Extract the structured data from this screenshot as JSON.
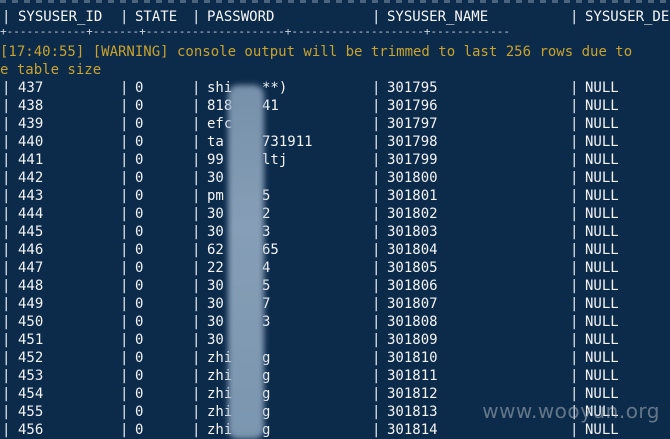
{
  "columns": [
    "SYSUSER_ID",
    "STATE",
    "PASSWORD",
    "SYSUSER_NAME",
    "SYSUSER_DE"
  ],
  "header_rule": "+------------+-------+---------------------+--------------------+------------",
  "warning_line1": "[17:40:55] [WARNING] console output will be trimmed to last 256 rows due to",
  "warning_line2": "e table size",
  "rows": [
    {
      "id": "437",
      "state": "0",
      "password": "shi",
      "password2": "**)",
      "name": "301795",
      "desc": "NULL"
    },
    {
      "id": "438",
      "state": "0",
      "password": "818",
      "password2": "41",
      "name": "301796",
      "desc": "NULL"
    },
    {
      "id": "439",
      "state": "0",
      "password": "efc",
      "password2": "",
      "name": "301797",
      "desc": "NULL"
    },
    {
      "id": "440",
      "state": "0",
      "password": "ta",
      "password2": "731911",
      "name": "301798",
      "desc": "NULL"
    },
    {
      "id": "441",
      "state": "0",
      "password": "99",
      "password2": "ltj",
      "name": "301799",
      "desc": "NULL"
    },
    {
      "id": "442",
      "state": "0",
      "password": "30",
      "password2": "",
      "name": "301800",
      "desc": "NULL"
    },
    {
      "id": "443",
      "state": "0",
      "password": "pm",
      "password2": "5",
      "name": "301801",
      "desc": "NULL"
    },
    {
      "id": "444",
      "state": "0",
      "password": "30",
      "password2": "2",
      "name": "301802",
      "desc": "NULL"
    },
    {
      "id": "445",
      "state": "0",
      "password": "30",
      "password2": "3",
      "name": "301803",
      "desc": "NULL"
    },
    {
      "id": "446",
      "state": "0",
      "password": "62",
      "password2": "65",
      "name": "301804",
      "desc": "NULL"
    },
    {
      "id": "447",
      "state": "0",
      "password": "22",
      "password2": "4",
      "name": "301805",
      "desc": "NULL"
    },
    {
      "id": "448",
      "state": "0",
      "password": "30",
      "password2": "5",
      "name": "301806",
      "desc": "NULL"
    },
    {
      "id": "449",
      "state": "0",
      "password": "30",
      "password2": "7",
      "name": "301807",
      "desc": "NULL"
    },
    {
      "id": "450",
      "state": "0",
      "password": "30",
      "password2": "3",
      "name": "301808",
      "desc": "NULL"
    },
    {
      "id": "451",
      "state": "0",
      "password": "30",
      "password2": "",
      "name": "301809",
      "desc": "NULL"
    },
    {
      "id": "452",
      "state": "0",
      "password": "zhi",
      "password2": "g",
      "name": "301810",
      "desc": "NULL"
    },
    {
      "id": "453",
      "state": "0",
      "password": "zhi",
      "password2": "g",
      "name": "301811",
      "desc": "NULL"
    },
    {
      "id": "454",
      "state": "0",
      "password": "zhi",
      "password2": "g",
      "name": "301812",
      "desc": "NULL"
    },
    {
      "id": "455",
      "state": "0",
      "password": "zhi",
      "password2": "g",
      "name": "301813",
      "desc": "NULL"
    },
    {
      "id": "456",
      "state": "0",
      "password": "zhi",
      "password2": "g",
      "name": "301814",
      "desc": "NULL"
    }
  ],
  "watermark": "www.wooyun.org",
  "colors": {
    "background": "#0c2a4a",
    "text": "#f2f4f6",
    "warning": "#c9a32e"
  }
}
